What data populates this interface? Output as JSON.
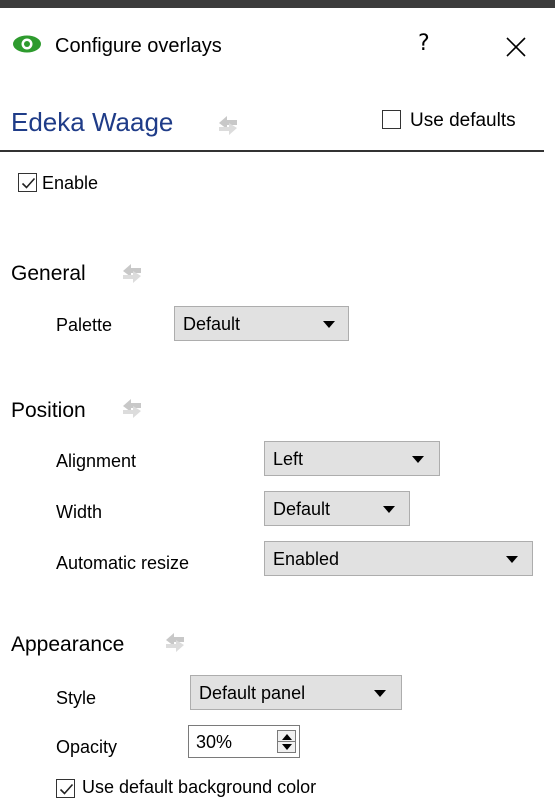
{
  "window": {
    "title": "Configure overlays",
    "help_label": "?",
    "close_icon": "close-icon",
    "app_icon": "eye-icon",
    "accent_color": "#1f3c88",
    "icon_green": "#2e9b2e"
  },
  "header": {
    "name": "Edeka Waage",
    "use_defaults_label": "Use defaults",
    "use_defaults_checked": false
  },
  "enable": {
    "label": "Enable",
    "checked": true
  },
  "general": {
    "title": "General",
    "palette_label": "Palette",
    "palette_value": "Default"
  },
  "position": {
    "title": "Position",
    "alignment_label": "Alignment",
    "alignment_value": "Left",
    "width_label": "Width",
    "width_value": "Default",
    "resize_label": "Automatic resize",
    "resize_value": "Enabled"
  },
  "appearance": {
    "title": "Appearance",
    "style_label": "Style",
    "style_value": "Default panel",
    "opacity_label": "Opacity",
    "opacity_value": "30%",
    "bg_color_label": "Use default background color",
    "bg_color_checked": true
  }
}
